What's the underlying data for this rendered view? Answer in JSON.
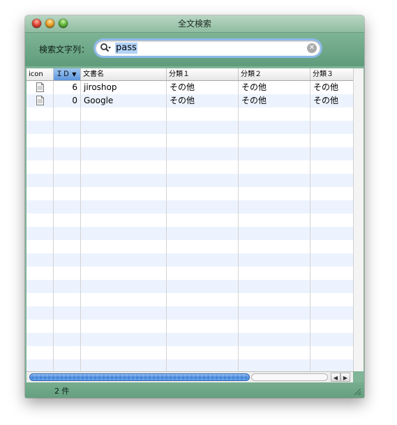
{
  "window": {
    "title": "全文検索"
  },
  "search": {
    "label": "検索文字列：",
    "value": "pass"
  },
  "table": {
    "columns": [
      {
        "label": "icon"
      },
      {
        "label": "ＩＤ",
        "sorted": "descending"
      },
      {
        "label": "文書名"
      },
      {
        "label": "分類１"
      },
      {
        "label": "分類２"
      },
      {
        "label": "分類３"
      }
    ],
    "rows": [
      {
        "icon": "document-icon",
        "id": "6",
        "name": "jiroshop",
        "cat1": "その他",
        "cat2": "その他",
        "cat3": "その他"
      },
      {
        "icon": "document-icon",
        "id": "0",
        "name": "Google",
        "cat1": "その他",
        "cat2": "その他",
        "cat3": "その他"
      }
    ]
  },
  "status": {
    "count": "2 件"
  },
  "colors": {
    "window_green": "#7fb497",
    "row_stripe": "#edf3fe",
    "focus_ring": "#8db8e8"
  }
}
